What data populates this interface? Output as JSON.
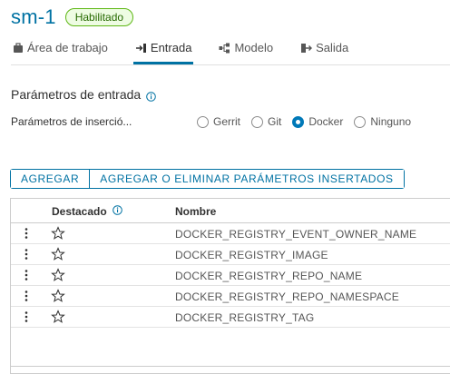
{
  "header": {
    "title": "sm-1",
    "status": "Habilitado"
  },
  "tabs": [
    {
      "label": "Área de trabajo",
      "icon": "workspace-icon"
    },
    {
      "label": "Entrada",
      "icon": "input-icon",
      "active": true
    },
    {
      "label": "Modelo",
      "icon": "model-icon"
    },
    {
      "label": "Salida",
      "icon": "output-icon"
    }
  ],
  "section": {
    "title": "Parámetros de entrada"
  },
  "injection": {
    "label": "Parámetros de inserció...",
    "options": [
      "Gerrit",
      "Git",
      "Docker",
      "Ninguno"
    ],
    "selected": "Docker"
  },
  "buttons": {
    "add": "AGREGAR",
    "add_remove": "AGREGAR O ELIMINAR PARÁMETROS INSERTADOS"
  },
  "table": {
    "columns": {
      "favorite": "Destacado",
      "name": "Nombre"
    },
    "rows": [
      "DOCKER_REGISTRY_EVENT_OWNER_NAME",
      "DOCKER_REGISTRY_IMAGE",
      "DOCKER_REGISTRY_REPO_NAME",
      "DOCKER_REGISTRY_REPO_NAMESPACE",
      "DOCKER_REGISTRY_TAG"
    ]
  },
  "colors": {
    "accent": "#0072a3",
    "status_green": "#5eb715"
  }
}
